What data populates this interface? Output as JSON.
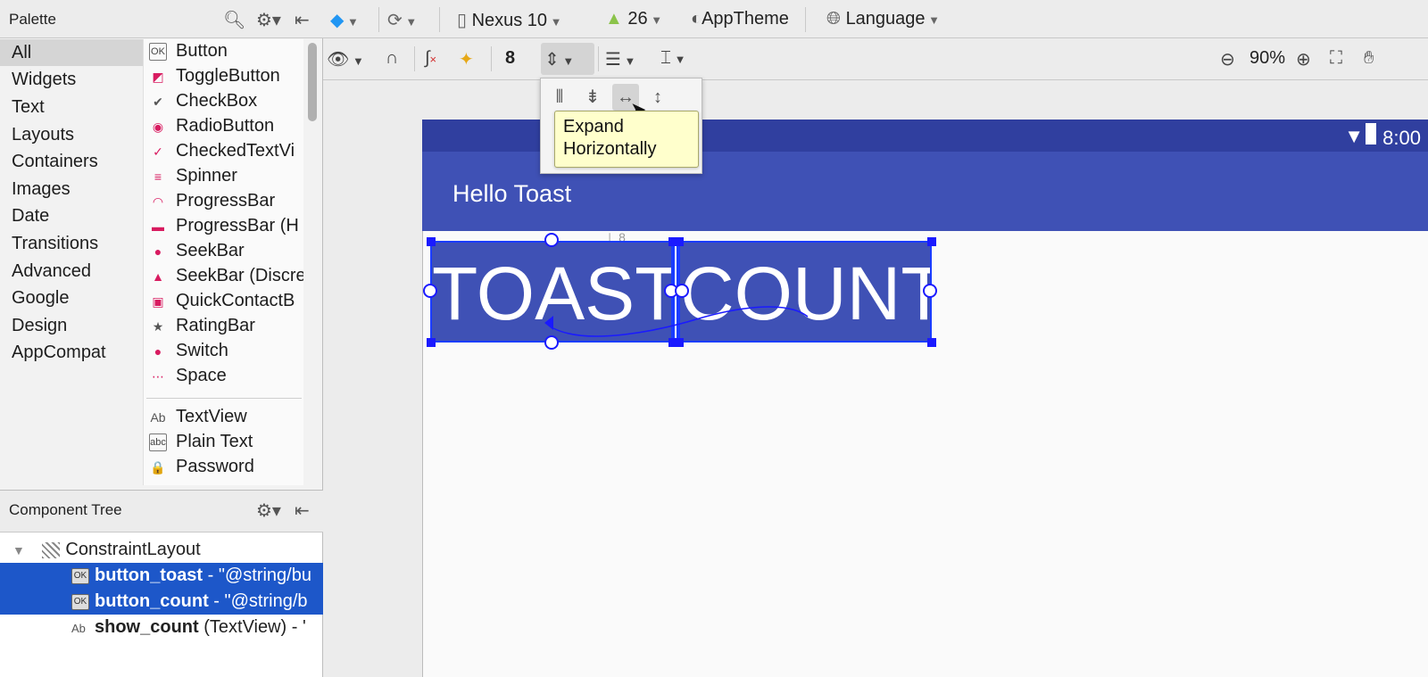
{
  "palette": {
    "title": "Palette",
    "categories": [
      "All",
      "Widgets",
      "Text",
      "Layouts",
      "Containers",
      "Images",
      "Date",
      "Transitions",
      "Advanced",
      "Google",
      "Design",
      "AppCompat"
    ],
    "widgets": [
      {
        "label": "Button",
        "icon": "OK"
      },
      {
        "label": "ToggleButton",
        "icon": "◩"
      },
      {
        "label": "CheckBox",
        "icon": "✔"
      },
      {
        "label": "RadioButton",
        "icon": "◉"
      },
      {
        "label": "CheckedTextVi",
        "icon": "✓"
      },
      {
        "label": "Spinner",
        "icon": "≡"
      },
      {
        "label": "ProgressBar",
        "icon": "◠"
      },
      {
        "label": "ProgressBar (H",
        "icon": "▬"
      },
      {
        "label": "SeekBar",
        "icon": "●"
      },
      {
        "label": "SeekBar (Discre",
        "icon": "▲"
      },
      {
        "label": "QuickContactB",
        "icon": "▣"
      },
      {
        "label": "RatingBar",
        "icon": "★"
      },
      {
        "label": "Switch",
        "icon": "●"
      },
      {
        "label": "Space",
        "icon": "⋯"
      }
    ],
    "text_widgets": [
      {
        "label": "TextView",
        "icon": "Ab"
      },
      {
        "label": "Plain Text",
        "icon": "abc"
      },
      {
        "label": "Password",
        "icon": "🔒"
      }
    ]
  },
  "component_tree": {
    "title": "Component Tree",
    "root": "ConstraintLayout",
    "items": [
      {
        "name": "button_toast",
        "suffix": " - \"@string/bu",
        "icon": "OK"
      },
      {
        "name": "button_count",
        "suffix": " - \"@string/b",
        "icon": "OK"
      },
      {
        "name": "show_count",
        "suffix": " (TextView) - '",
        "icon": "Ab"
      }
    ]
  },
  "toolbar": {
    "device": "Nexus 10",
    "api_level": "26",
    "theme": "AppTheme",
    "language": "Language",
    "margin": "8",
    "zoom": "90%"
  },
  "popup": {
    "tooltip_line1": "Expand",
    "tooltip_line2": "Horizontally"
  },
  "device": {
    "status_time": "8:00",
    "app_title": "Hello Toast",
    "button_toast": "TOAST",
    "button_count": "COUNT",
    "constraint_margin": "8"
  }
}
